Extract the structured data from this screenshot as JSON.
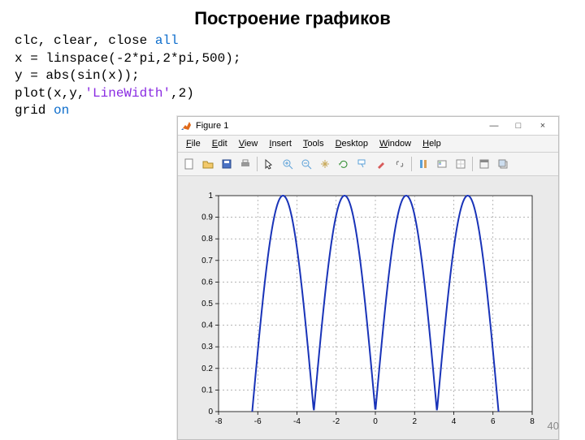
{
  "page": {
    "title": "Построение графиков",
    "page_number": "40"
  },
  "code": {
    "l1a": "clc, clear, close ",
    "l1b": "all",
    "l2": "x = linspace(-2*pi,2*pi,500);",
    "l3": "y = abs(sin(x));",
    "l4a": "plot(x,y,",
    "l4b": "'LineWidth'",
    "l4c": ",2)",
    "l5a": "grid ",
    "l5b": "on"
  },
  "window": {
    "title": "Figure 1",
    "min": "—",
    "max": "□",
    "close": "×"
  },
  "menu": {
    "file": "File",
    "edit": "Edit",
    "view": "View",
    "insert": "Insert",
    "tools": "Tools",
    "desktop": "Desktop",
    "window": "Window",
    "help": "Help"
  },
  "chart_data": {
    "type": "line",
    "title": "",
    "xlabel": "",
    "ylabel": "",
    "xlim": [
      -8,
      8
    ],
    "ylim": [
      0,
      1
    ],
    "xticks": [
      -8,
      -6,
      -4,
      -2,
      0,
      2,
      4,
      6,
      8
    ],
    "yticks": [
      0,
      0.1,
      0.2,
      0.3,
      0.4,
      0.5,
      0.6,
      0.7,
      0.8,
      0.9,
      1
    ],
    "grid": true,
    "series": [
      {
        "name": "abs(sin(x))",
        "color": "#1933b8",
        "linewidth": 2,
        "function": "|sin(x)|",
        "x_domain": [
          -6.2832,
          6.2832
        ],
        "n_points": 500
      }
    ]
  }
}
